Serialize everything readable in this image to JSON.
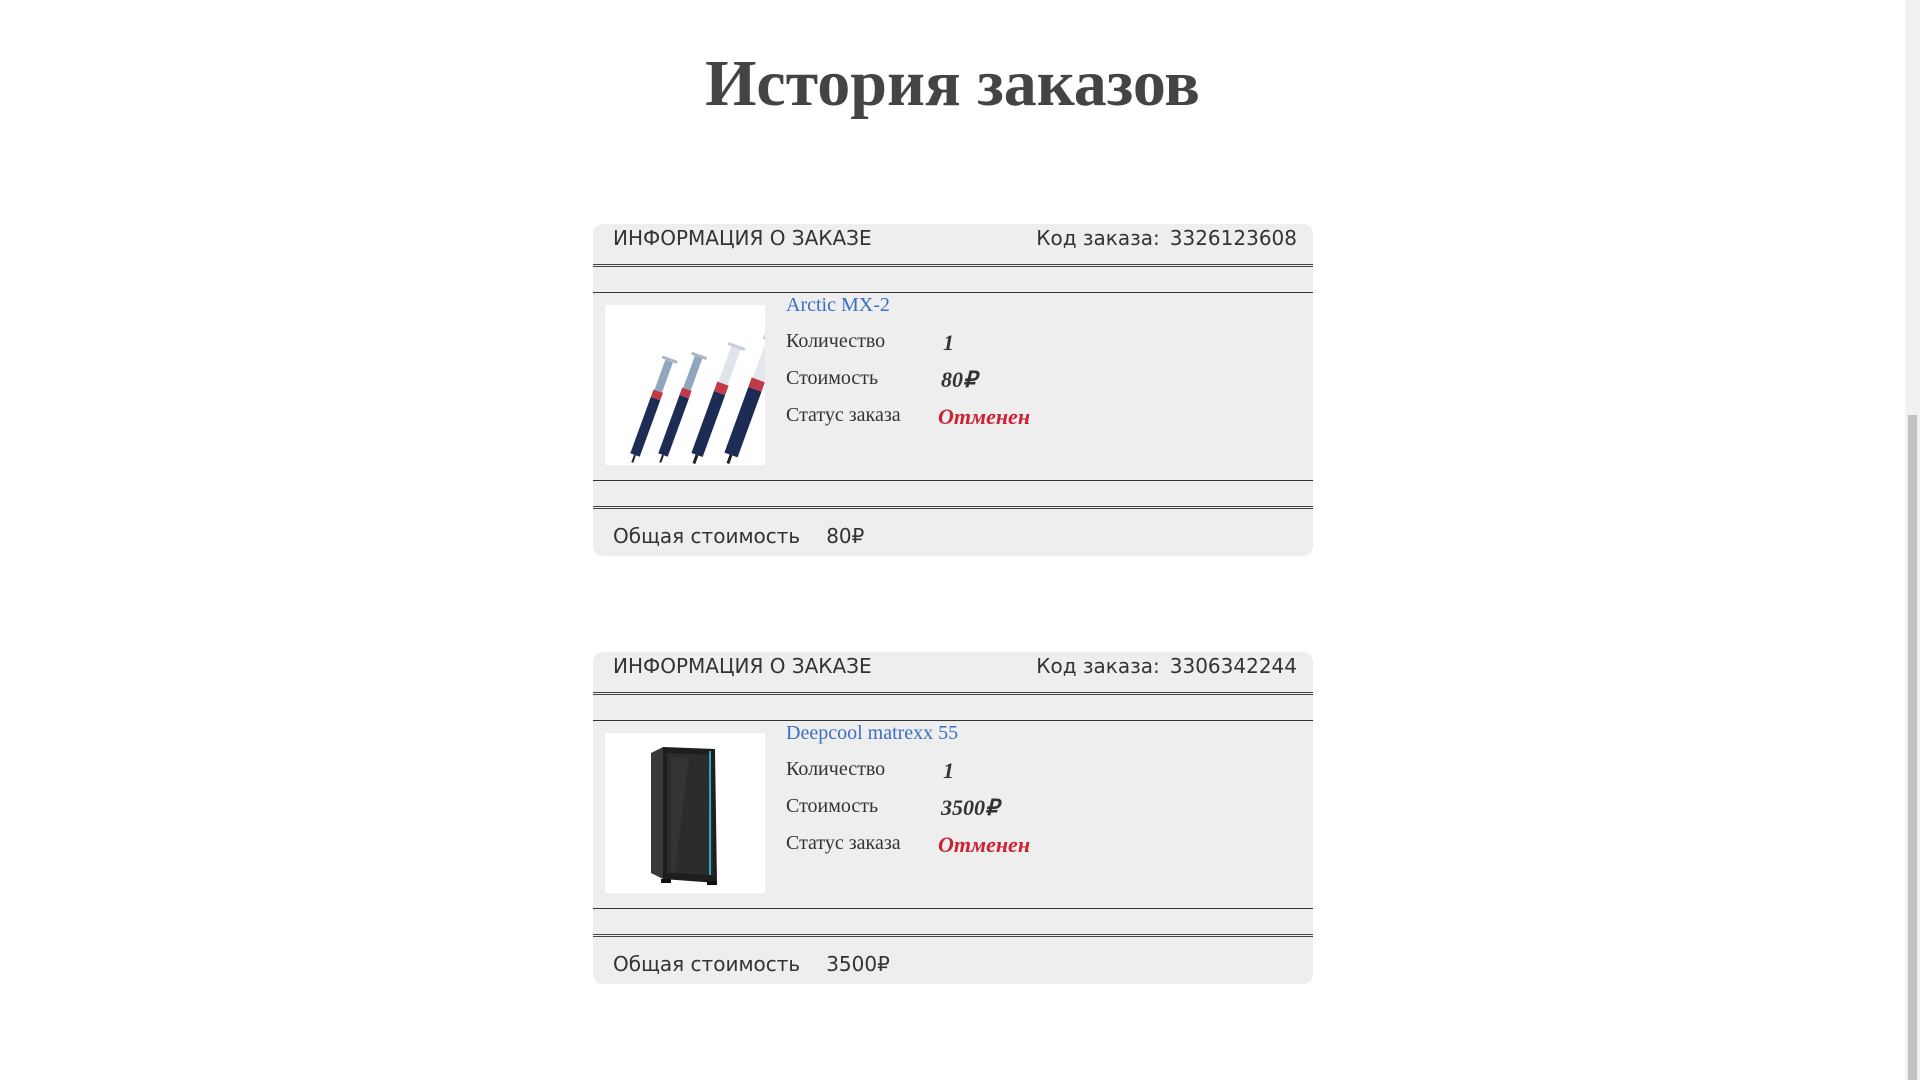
{
  "page": {
    "title": "История заказов"
  },
  "labels": {
    "order_info": "ИНФОРМАЦИЯ О ЗАКАЗЕ",
    "order_code": "Код заказа:",
    "quantity": "Количество",
    "cost": "Стоимость",
    "status": "Статус заказа",
    "total": "Общая стоимость"
  },
  "orders": [
    {
      "code": "3326123608",
      "product": {
        "name": "Arctic MX-2",
        "image_icon": "thermal-paste-syringes-image"
      },
      "quantity": "1",
      "cost": "80₽",
      "status": "Отменен",
      "total": "80₽"
    },
    {
      "code": "3306342244",
      "product": {
        "name": "Deepcool matrexx 55",
        "image_icon": "pc-case-image"
      },
      "quantity": "1",
      "cost": "3500₽",
      "status": "Отменен",
      "total": "3500₽"
    }
  ],
  "colors": {
    "link": "#3a6fc4",
    "status_cancelled": "#cc2233",
    "card_background": "#eeeeee"
  }
}
